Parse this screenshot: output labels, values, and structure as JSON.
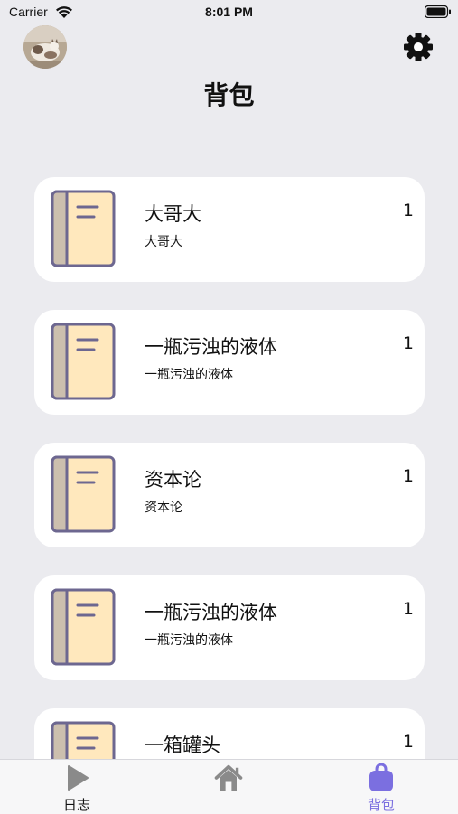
{
  "status_bar": {
    "carrier": "Carrier",
    "time": "8:01 PM"
  },
  "header": {
    "title": "背包",
    "avatar_icon": "cat-photo-avatar",
    "settings_icon": "gear-icon"
  },
  "colors": {
    "background": "#ebebef",
    "card": "#ffffff",
    "book_cover": "#ffe8bd",
    "book_spine": "#ccbfae",
    "book_outline": "#6d6790",
    "tab_active": "#7b6fe0",
    "tab_inactive": "#8a8a8a"
  },
  "items": [
    {
      "name": "大哥大",
      "description": "大哥大",
      "count": "1",
      "icon": "book-icon"
    },
    {
      "name": "一瓶污浊的液体",
      "description": "一瓶污浊的液体",
      "count": "1",
      "icon": "book-icon"
    },
    {
      "name": "资本论",
      "description": "资本论",
      "count": "1",
      "icon": "book-icon"
    },
    {
      "name": "一瓶污浊的液体",
      "description": "一瓶污浊的液体",
      "count": "1",
      "icon": "book-icon"
    },
    {
      "name": "一箱罐头",
      "description": "",
      "count": "1",
      "icon": "book-icon"
    }
  ],
  "tabs": [
    {
      "label": "日志",
      "icon": "play-icon",
      "active": false
    },
    {
      "label": "",
      "icon": "home-icon",
      "active": false
    },
    {
      "label": "背包",
      "icon": "bag-icon",
      "active": true
    }
  ]
}
